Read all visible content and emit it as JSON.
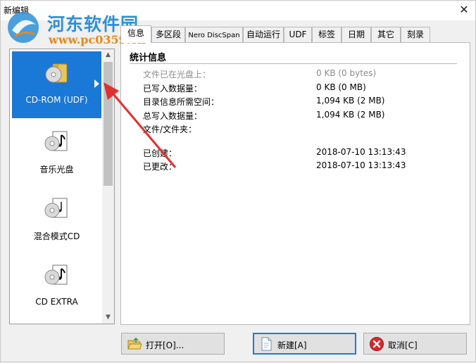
{
  "window": {
    "title": "新编辑",
    "close_glyph": "✕"
  },
  "watermark": {
    "site_name": "河东软件园",
    "url": "www.pc0359.cn"
  },
  "tabs": [
    {
      "label": "信息",
      "active": true
    },
    {
      "label": "多区段"
    },
    {
      "label": "Nero DiscSpan"
    },
    {
      "label": "自动运行"
    },
    {
      "label": "UDF"
    },
    {
      "label": "标签"
    },
    {
      "label": "日期"
    },
    {
      "label": "其它"
    },
    {
      "label": "刻录"
    }
  ],
  "media_list": [
    {
      "label": "CD-ROM (UDF)",
      "icon": "cd-rom-folder-icon",
      "selected": true
    },
    {
      "label": "音乐光盘",
      "icon": "music-cd-icon"
    },
    {
      "label": "混合模式CD",
      "icon": "mixed-mode-cd-icon"
    },
    {
      "label": "CD EXTRA",
      "icon": "cd-extra-icon"
    }
  ],
  "info": {
    "heading": "统计信息",
    "rows": [
      {
        "label": "文件已在光盘上：",
        "value": "0 KB (0 bytes)",
        "dim": true
      },
      {
        "label": "已写入数据量：",
        "value": "0 KB (0 MB)"
      },
      {
        "label": "目录信息所需空间：",
        "value": "1,094 KB (2 MB)"
      },
      {
        "label": "总写入数据量：",
        "value": "1,094 KB (2 MB)"
      },
      {
        "label": "文件/文件夹：",
        "value": ""
      },
      {
        "label": "已创建：",
        "value": "2018-07-10 13:13:43"
      },
      {
        "label": "已更改：",
        "value": "2018-07-10 13:13:43"
      }
    ]
  },
  "buttons": {
    "open": "打开[O]...",
    "new": "新建[A]",
    "cancel": "取消[C]"
  },
  "colors": {
    "selection": "#1a78d6",
    "annotation_arrow": "#e03131",
    "watermark_blue": "#2e8fd8",
    "watermark_orange": "#e38a1c"
  }
}
